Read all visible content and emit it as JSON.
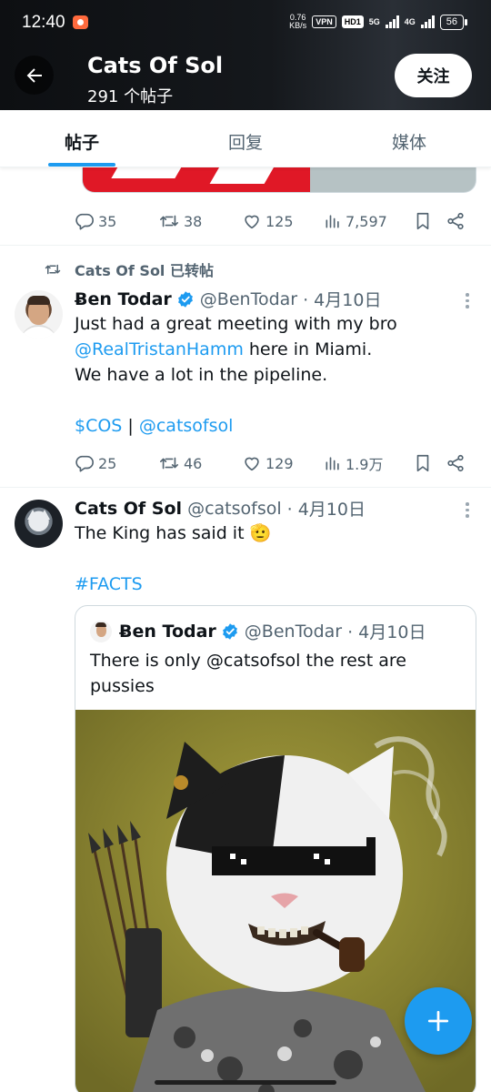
{
  "status_bar": {
    "time": "12:40",
    "net_speed_value": "0.76",
    "net_speed_unit": "KB/s",
    "vpn_label": "VPN",
    "hd_label": "HD1",
    "signal1_label": "5G",
    "signal2_label": "4G",
    "battery": "56"
  },
  "header": {
    "title": "Cats Of Sol",
    "subtitle": "291 个帖子",
    "follow_label": "关注"
  },
  "tabs": [
    {
      "label": "帖子",
      "active": true
    },
    {
      "label": "回复",
      "active": false
    },
    {
      "label": "媒体",
      "active": false
    }
  ],
  "posts": [
    {
      "metrics": {
        "replies": "35",
        "reposts": "38",
        "likes": "125",
        "views": "7,597"
      }
    },
    {
      "repost_label": "Cats Of Sol 已转帖",
      "author": {
        "name": "Ƀen Todar",
        "handle": "@BenTodar",
        "date": "· 4月10日",
        "verified": true
      },
      "text_line1": "Just had a great meeting with my bro",
      "mention": "@RealTristanHamm",
      "text_line2_rest": " here in Miami.",
      "text_line3": "We have a lot in the pipeline.",
      "cashtag": "$COS",
      "separator": " | ",
      "mention2": "@catsofsol",
      "metrics": {
        "replies": "25",
        "reposts": "46",
        "likes": "129",
        "views": "1.9万"
      }
    },
    {
      "author": {
        "name": "Cats Of Sol",
        "handle": "@catsofsol",
        "date": "· 4月10日",
        "verified": false
      },
      "text_line1": "The King has said it",
      "emoji": "🫡",
      "hashtag": "#FACTS",
      "quote": {
        "author": {
          "name": "Ƀen Todar",
          "handle": "@BenTodar",
          "date": "· 4月10日",
          "verified": true
        },
        "text_line1": "There is only @catsofsol the rest are",
        "text_line2": "pussies"
      }
    }
  ],
  "icons": {
    "back": "arrow-left-icon",
    "reply": "reply-icon",
    "repost": "repost-icon",
    "like": "heart-icon",
    "views": "views-icon",
    "bookmark": "bookmark-icon",
    "share": "share-icon",
    "more": "more-vertical-icon",
    "compose": "plus-icon"
  },
  "colors": {
    "accent": "#1d9bf0",
    "text_primary": "#0f1419",
    "text_secondary": "#536471"
  }
}
